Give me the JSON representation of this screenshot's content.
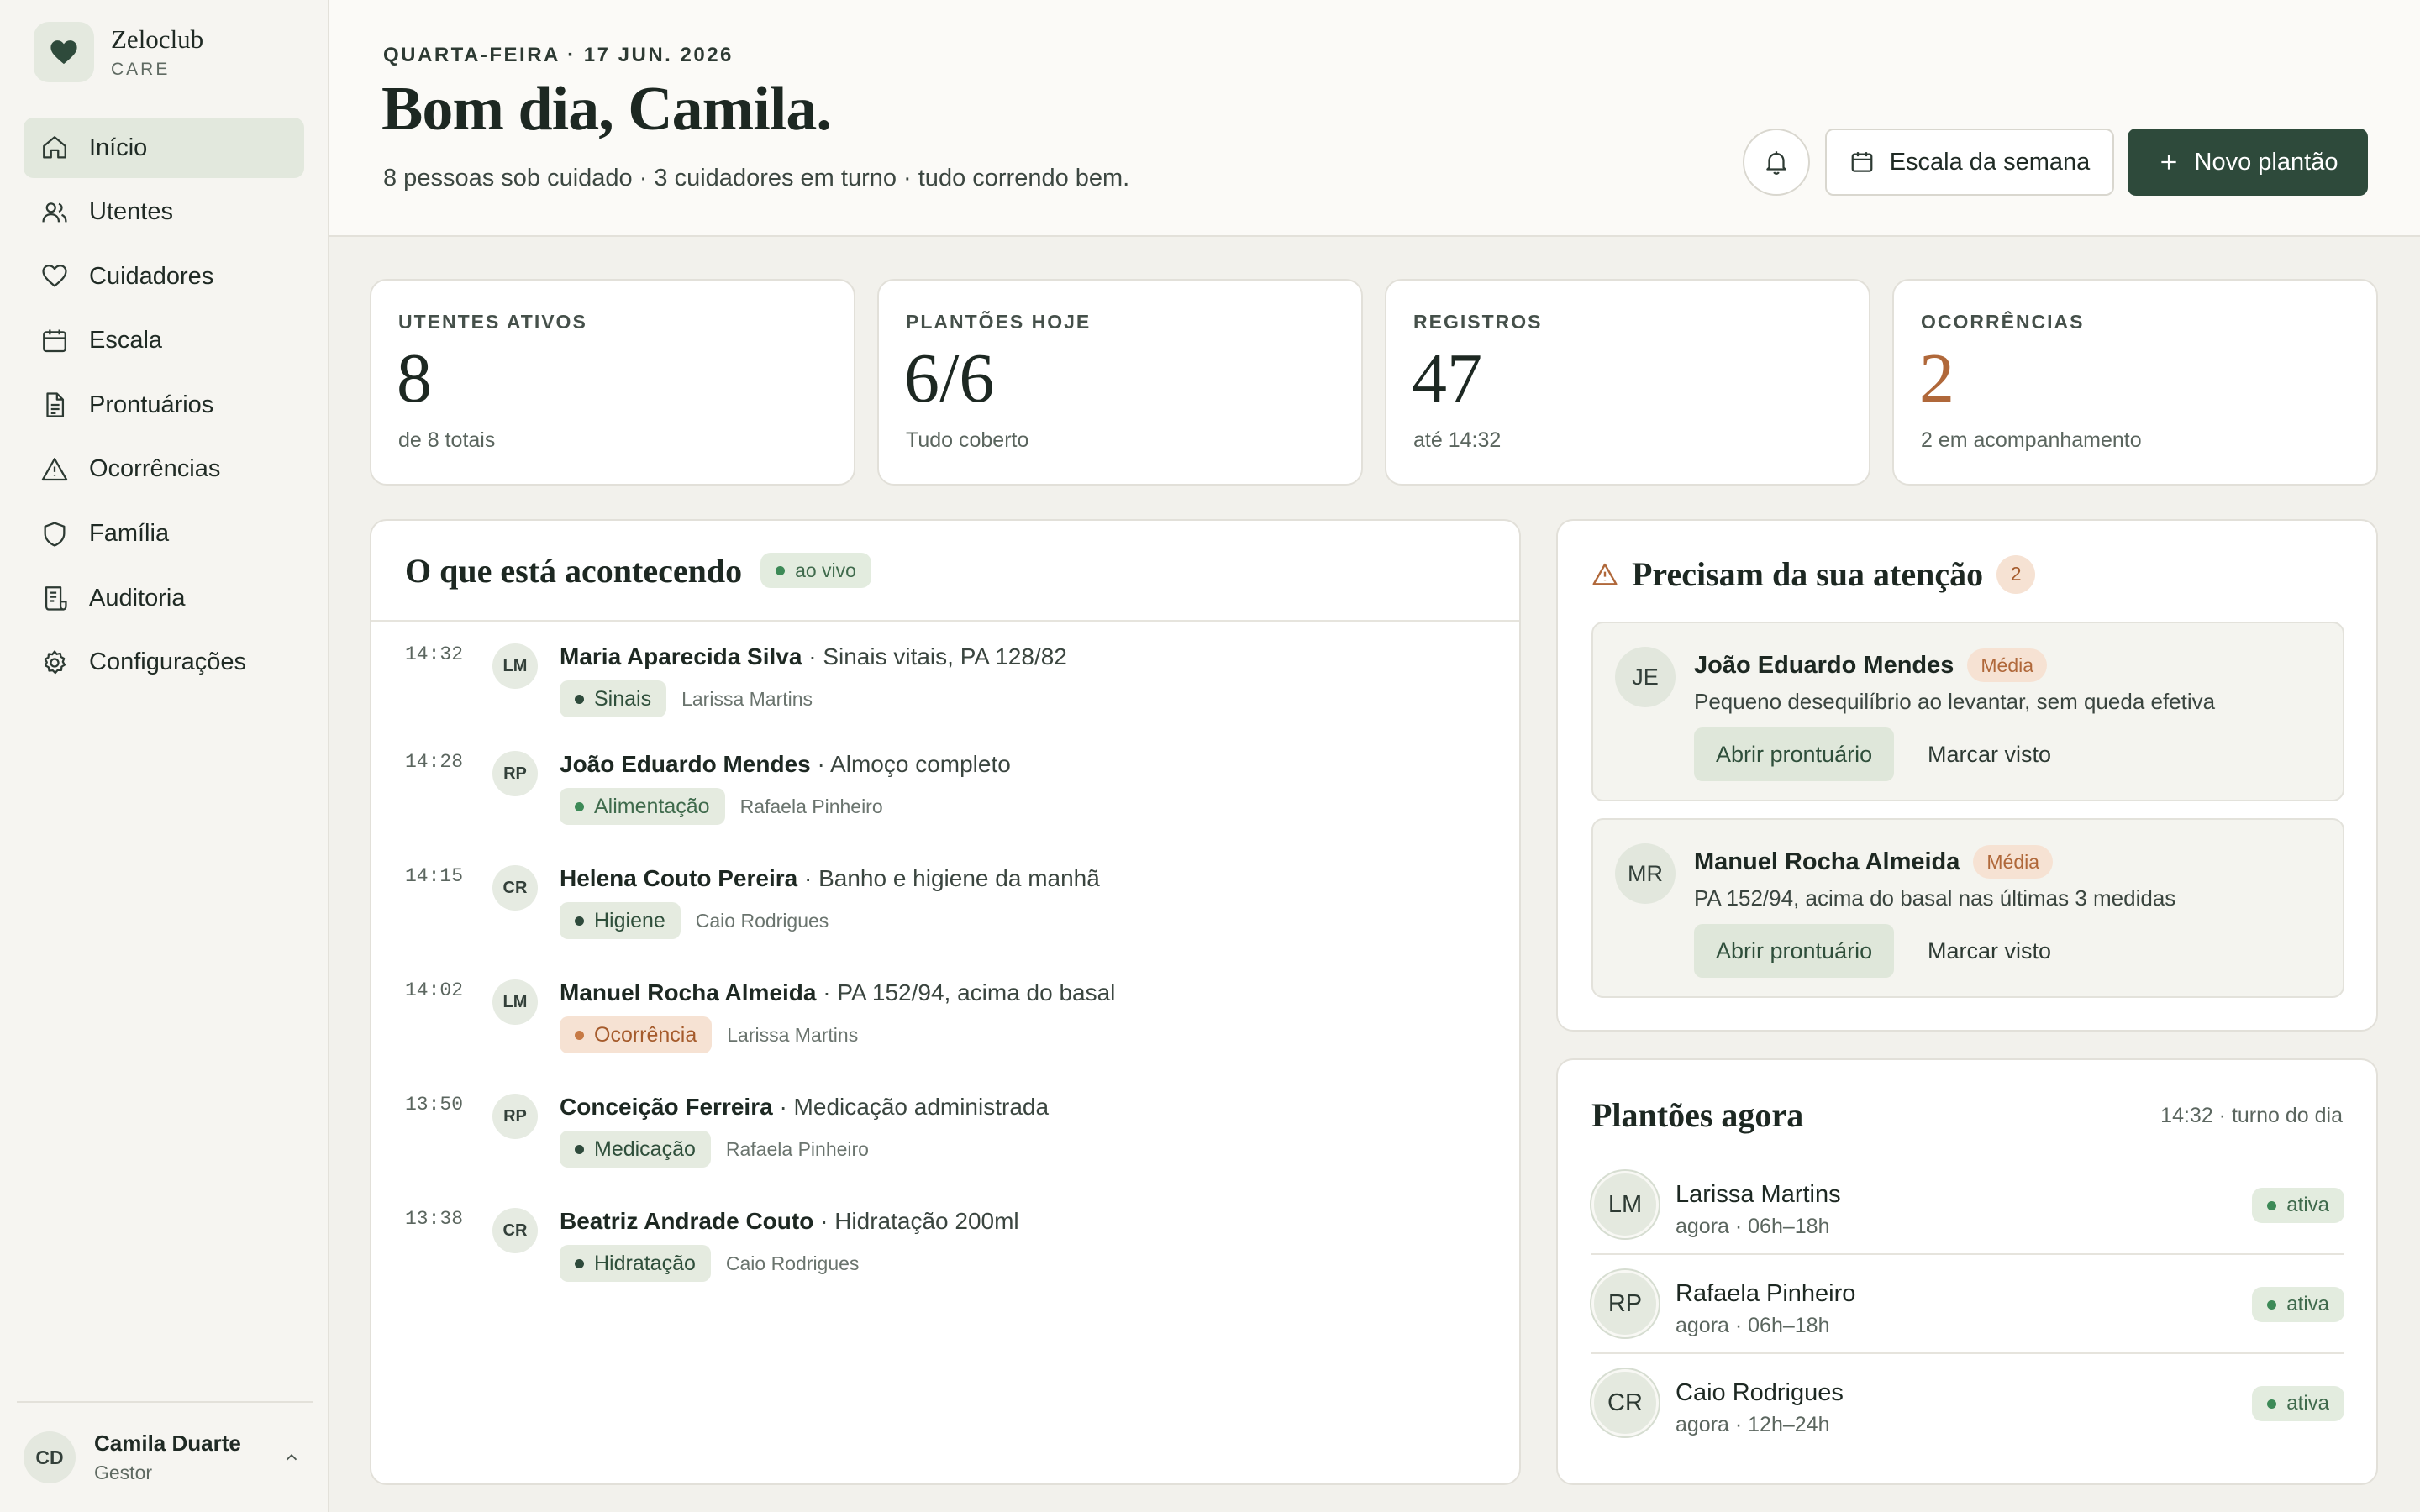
{
  "brand": {
    "name": "Zeloclub",
    "sub": "CARE"
  },
  "nav": [
    {
      "label": "Início",
      "icon": "home-icon",
      "active": true
    },
    {
      "label": "Utentes",
      "icon": "users-icon"
    },
    {
      "label": "Cuidadores",
      "icon": "heart-icon"
    },
    {
      "label": "Escala",
      "icon": "calendar-icon"
    },
    {
      "label": "Prontuários",
      "icon": "file-icon"
    },
    {
      "label": "Ocorrências",
      "icon": "alert-triangle-icon"
    },
    {
      "label": "Família",
      "icon": "shield-icon"
    },
    {
      "label": "Auditoria",
      "icon": "audit-icon"
    },
    {
      "label": "Configurações",
      "icon": "gear-icon"
    }
  ],
  "user": {
    "initials": "CD",
    "name": "Camila Duarte",
    "role": "Gestor"
  },
  "header": {
    "date": "QUARTA-FEIRA · 17 JUN. 2026",
    "greeting": "Bom dia, Camila.",
    "summary": "8 pessoas sob cuidado · 3 cuidadores em turno · tudo correndo bem.",
    "week_button": "Escala da semana",
    "new_button": "Novo plantão"
  },
  "stats": [
    {
      "label": "UTENTES ATIVOS",
      "value": "8",
      "note": "de 8 totais"
    },
    {
      "label": "PLANTÕES HOJE",
      "value": "6/6",
      "note": "Tudo coberto"
    },
    {
      "label": "REGISTROS",
      "value": "47",
      "note": "até 14:32"
    },
    {
      "label": "OCORRÊNCIAS",
      "value": "2",
      "note": "2 em acompanhamento",
      "accent": "#b0683a"
    }
  ],
  "feed": {
    "title": "O que está acontecendo",
    "live": "ao vivo",
    "items": [
      {
        "time": "14:32",
        "initials": "LM",
        "name": "Maria Aparecida Silva",
        "action": " · Sinais vitais, PA 128/82",
        "tag": "Sinais",
        "tag_type": "dark",
        "by": "Larissa Martins"
      },
      {
        "time": "14:28",
        "initials": "RP",
        "name": "João Eduardo Mendes",
        "action": " · Almoço completo",
        "tag": "Alimentação",
        "tag_type": "green",
        "by": "Rafaela Pinheiro"
      },
      {
        "time": "14:15",
        "initials": "CR",
        "name": "Helena Couto Pereira",
        "action": " · Banho e higiene da manhã",
        "tag": "Higiene",
        "tag_type": "dark",
        "by": "Caio Rodrigues"
      },
      {
        "time": "14:02",
        "initials": "LM",
        "name": "Manuel Rocha Almeida",
        "action": " · PA 152/94, acima do basal",
        "tag": "Ocorrência",
        "tag_type": "alert",
        "by": "Larissa Martins"
      },
      {
        "time": "13:50",
        "initials": "RP",
        "name": "Conceição Ferreira",
        "action": " · Medicação administrada",
        "tag": "Medicação",
        "tag_type": "dark",
        "by": "Rafaela Pinheiro"
      },
      {
        "time": "13:38",
        "initials": "CR",
        "name": "Beatriz Andrade Couto",
        "action": " · Hidratação 200ml",
        "tag": "Hidratação",
        "tag_type": "dark",
        "by": "Caio Rodrigues"
      }
    ]
  },
  "attention": {
    "title": "Precisam da sua atenção",
    "count": "2",
    "items": [
      {
        "initials": "JE",
        "name": "João Eduardo Mendes",
        "severity": "Média",
        "desc": "Pequeno desequilíbrio ao levantar, sem queda efetiva",
        "open": "Abrir prontuário",
        "seen": "Marcar visto"
      },
      {
        "initials": "MR",
        "name": "Manuel Rocha Almeida",
        "severity": "Média",
        "desc": "PA 152/94, acima do basal nas últimas 3 medidas",
        "open": "Abrir prontuário",
        "seen": "Marcar visto"
      }
    ]
  },
  "shifts": {
    "title": "Plantões agora",
    "note": "14:32 · turno do dia",
    "items": [
      {
        "initials": "LM",
        "name": "Larissa Martins",
        "time": "agora · 06h–18h",
        "status": "ativa"
      },
      {
        "initials": "RP",
        "name": "Rafaela Pinheiro",
        "time": "agora · 06h–18h",
        "status": "ativa"
      },
      {
        "initials": "CR",
        "name": "Caio Rodrigues",
        "time": "agora · 12h–24h",
        "status": "ativa"
      }
    ]
  },
  "colors": {
    "primary": "#2e4a3b",
    "accent_warn": "#b0683a",
    "live_green": "#3d8a57",
    "background": "#f2f1ec"
  }
}
